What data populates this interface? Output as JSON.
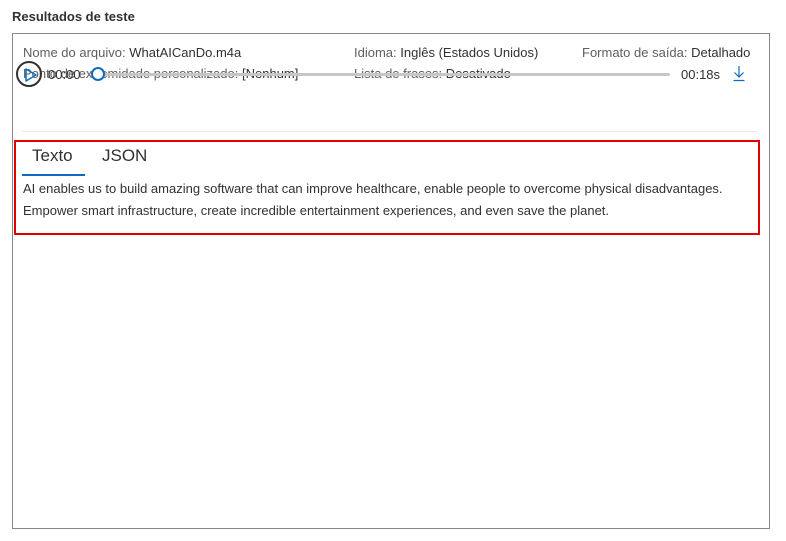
{
  "section_title": "Resultados de teste",
  "meta": {
    "file_label": "Nome do arquivo:",
    "file_value": "WhatAICanDo.m4a",
    "language_label": "Idioma:",
    "language_value": "Inglês (Estados Unidos)",
    "output_label": "Formato de saída:",
    "output_value": "Detalhado",
    "endpoint_label": "Ponto de extremidade personalizado:",
    "endpoint_value": "[Nenhum]",
    "phrase_label": "Lista de frases:",
    "phrase_value": "Desativado"
  },
  "player": {
    "current_time": "00:00",
    "duration": "00:18s",
    "progress": 0,
    "play_icon": "play-icon",
    "download_icon": "download-icon"
  },
  "tabs": [
    {
      "label": "Texto",
      "selected": true
    },
    {
      "label": "JSON",
      "selected": false
    }
  ],
  "result_text": "AI enables us to build amazing software that can improve healthcare, enable people to overcome physical disadvantages. Empower smart infrastructure, create incredible entertainment experiences, and even save the planet.",
  "colors": {
    "accent": "#0f6cbd",
    "highlight": "#e00000",
    "border": "#8a8886"
  }
}
